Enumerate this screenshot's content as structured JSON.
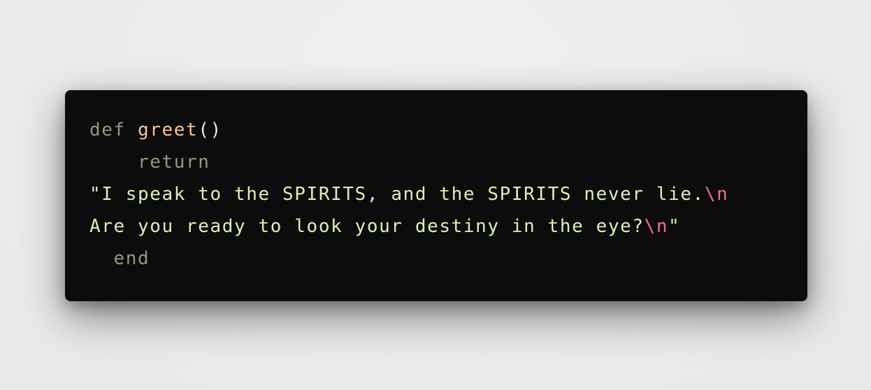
{
  "code": {
    "line1": {
      "keyword": "def",
      "function_name": "greet",
      "parens": "()"
    },
    "line2": {
      "indent": "    ",
      "keyword": "return"
    },
    "line3": {
      "text": "\"I speak to the SPIRITS, and the SPIRITS never lie.",
      "escape": "\\n"
    },
    "line4": {
      "text": "Are you ready to look your destiny in the eye?",
      "escape": "\\n",
      "close_quote": "\""
    },
    "line5": {
      "indent": "  ",
      "keyword": "end"
    }
  },
  "colors": {
    "background": "#0c0c0c",
    "keyword": "#8a9d78",
    "function": "#f8c290",
    "string": "#d9f2b4",
    "escape": "#ee6b96"
  }
}
